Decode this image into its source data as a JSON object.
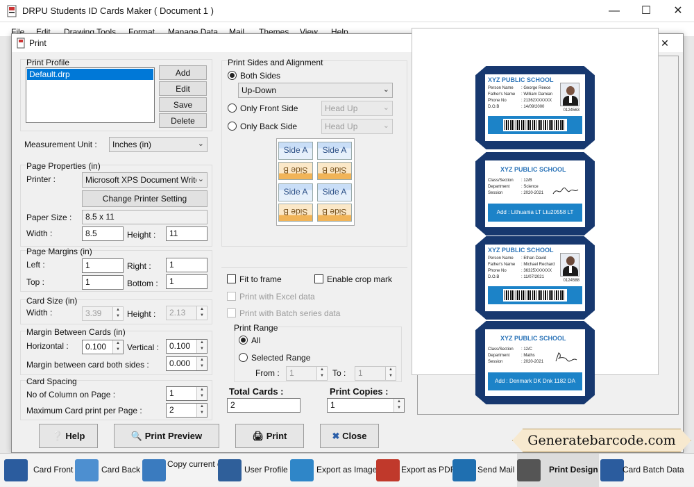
{
  "app": {
    "title": "DRPU Students ID Cards Maker ( Document 1 )"
  },
  "menu": [
    "File",
    "Edit",
    "Drawing Tools",
    "Format",
    "Manage Data",
    "Mail",
    "Themes",
    "View",
    "Help"
  ],
  "dialog": {
    "title": "Print",
    "print_profile": {
      "label": "Print Profile",
      "items": [
        "Default.drp"
      ],
      "selected": "Default.drp",
      "buttons": {
        "add": "Add",
        "edit": "Edit",
        "save": "Save",
        "delete": "Delete"
      }
    },
    "measurement_unit": {
      "label": "Measurement Unit :",
      "value": "Inches (in)"
    },
    "page_properties": {
      "label": "Page Properties (in)",
      "printer_label": "Printer :",
      "printer_value": "Microsoft XPS Document Writer",
      "change_printer": "Change Printer Setting",
      "paper_size_label": "Paper Size :",
      "paper_size_value": "8.5 x 11",
      "width_label": "Width :",
      "width_value": "8.5",
      "height_label": "Height :",
      "height_value": "11"
    },
    "page_margins": {
      "label": "Page Margins (in)",
      "left_label": "Left :",
      "left_value": "1",
      "right_label": "Right :",
      "right_value": "1",
      "top_label": "Top :",
      "top_value": "1",
      "bottom_label": "Bottom :",
      "bottom_value": "1"
    },
    "card_size": {
      "label": "Card Size (in)",
      "width_label": "Width :",
      "width_value": "3.39",
      "height_label": "Height :",
      "height_value": "2.13"
    },
    "margin_between_cards": {
      "label": "Margin Between Cards (in)",
      "horizontal_label": "Horizontal :",
      "horizontal_value": "0.100",
      "vertical_label": "Vertical :",
      "vertical_value": "0.100",
      "both_sides_label": "Margin between card both sides :",
      "both_sides_value": "0.000"
    },
    "card_spacing": {
      "label": "Card Spacing",
      "columns_label": "No of Column on Page :",
      "columns_value": "1",
      "max_label": "Maximum Card print per Page :",
      "max_value": "2"
    },
    "print_sides": {
      "label": "Print Sides and Alignment",
      "both_sides": "Both Sides",
      "both_value": "Up-Down",
      "front_only": "Only Front Side",
      "front_value": "Head Up",
      "back_only": "Only Back Side",
      "back_value": "Head Up",
      "side_a": "Side A",
      "side_b": "Side B"
    },
    "options": {
      "fit_to_frame": "Fit to frame",
      "enable_crop": "Enable crop mark",
      "print_excel": "Print with Excel data",
      "print_batch": "Print with Batch series data"
    },
    "print_range": {
      "label": "Print Range",
      "all": "All",
      "selected": "Selected Range",
      "from_label": "From :",
      "from_value": "1",
      "to_label": "To :",
      "to_value": "1"
    },
    "total_cards": {
      "label": "Total Cards :",
      "value": "2"
    },
    "print_copies": {
      "label": "Print Copies :",
      "value": "1"
    },
    "buttons": {
      "help": "Help",
      "preview": "Print Preview",
      "print": "Print",
      "close": "Close"
    }
  },
  "preview": {
    "cards": [
      {
        "side": "front",
        "school": "XYZ PUBLIC SCHOOL",
        "rows": [
          {
            "k": "Person Name",
            "v": ": George Reece"
          },
          {
            "k": "Father's Name",
            "v": ": William Damian"
          },
          {
            "k": "Phone No",
            "v": ": 21362XXXXXX"
          },
          {
            "k": "D.O.B",
            "v": ": 14/09/2000"
          }
        ],
        "id": "0124563"
      },
      {
        "side": "back",
        "school": "XYZ PUBLIC SCHOOL",
        "rows": [
          {
            "k": "Class/Section",
            "v": ": 12/B"
          },
          {
            "k": "Department",
            "v": ": Science"
          },
          {
            "k": "Session",
            "v": ": 2020-2021"
          }
        ],
        "address": "Add : Lithuania LT Ltu20558 LT"
      },
      {
        "side": "front",
        "school": "XYZ PUBLIC SCHOOL",
        "rows": [
          {
            "k": "Person Name",
            "v": ": Ethan David"
          },
          {
            "k": "Father's Name",
            "v": ": Michael Rechard"
          },
          {
            "k": "Phone No",
            "v": ": 36325XXXXXX"
          },
          {
            "k": "D.O.B",
            "v": ": 11/07/2021"
          }
        ],
        "id": "0124588"
      },
      {
        "side": "back",
        "school": "XYZ PUBLIC SCHOOL",
        "rows": [
          {
            "k": "Class/Section",
            "v": ": 12/C"
          },
          {
            "k": "Department",
            "v": ": Maths"
          },
          {
            "k": "Session",
            "v": ": 2020-2021"
          }
        ],
        "address": "Add : Denmark DK Dnk 1182 DA"
      }
    ]
  },
  "banner": "Generatebarcode.com",
  "taskbar": [
    {
      "label": "Card Front",
      "icon": "card-front-icon",
      "color": "#2b5c9e"
    },
    {
      "label": "Card Back",
      "icon": "card-back-icon",
      "color": "#4d8fd0"
    },
    {
      "label": "Copy current design",
      "icon": "copy-design-icon",
      "color": "#3a7bbf"
    },
    {
      "label": "User Profile",
      "icon": "user-profile-icon",
      "color": "#2f5f9a"
    },
    {
      "label": "Export as Image",
      "icon": "export-image-icon",
      "color": "#2f86c8"
    },
    {
      "label": "Export as PDF",
      "icon": "export-pdf-icon",
      "color": "#c0392b"
    },
    {
      "label": "Send Mail",
      "icon": "send-mail-icon",
      "color": "#1f6fb0"
    },
    {
      "label": "Print Design",
      "icon": "print-design-icon",
      "color": "#555555"
    },
    {
      "label": "Card Batch Data",
      "icon": "card-batch-icon",
      "color": "#2b5c9e"
    }
  ]
}
